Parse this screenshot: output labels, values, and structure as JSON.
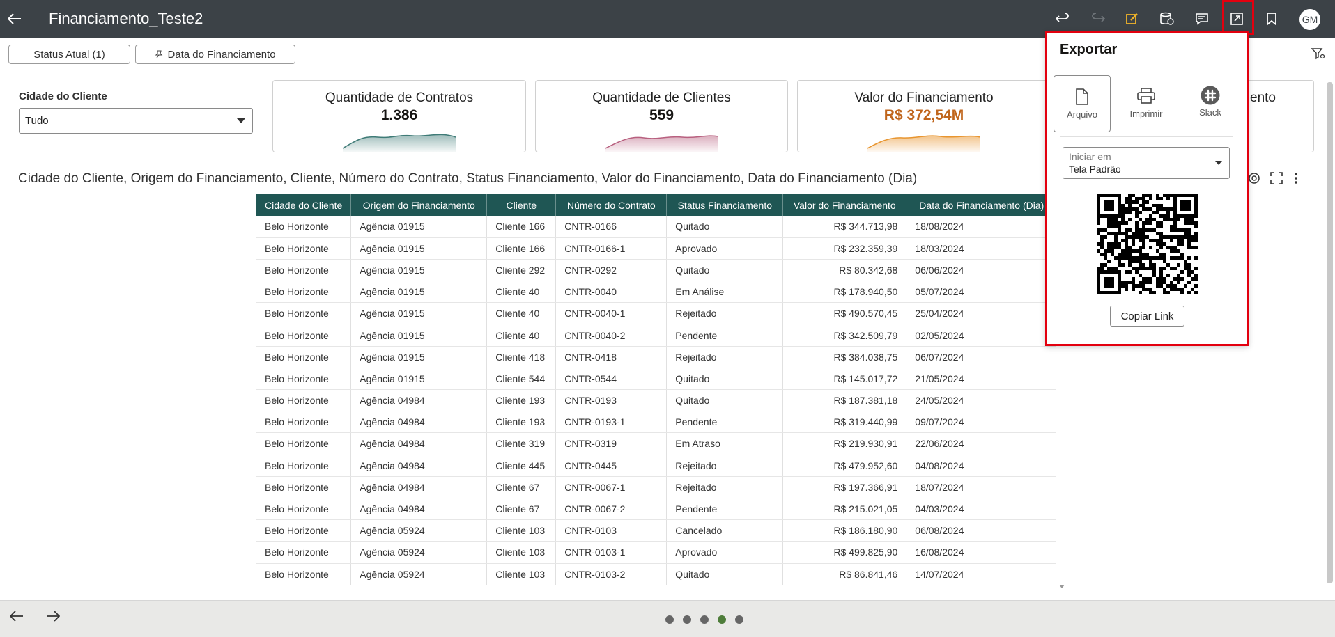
{
  "app": {
    "title": "Financiamento_Teste2",
    "user_initials": "GM"
  },
  "filters": {
    "chips": [
      "Status Atual (1)",
      "Data do Financiamento"
    ],
    "cidade_label": "Cidade do Cliente",
    "cidade_value": "Tudo"
  },
  "kpis": [
    {
      "title": "Quantidade de Contratos",
      "value": "1.386",
      "color": "#3f7b77"
    },
    {
      "title": "Quantidade de Clientes",
      "value": "559",
      "color": "#b8607f"
    },
    {
      "title": "Valor do Financiamento",
      "value": "R$ 372,54M",
      "color": "#e8952f"
    },
    {
      "title": "ento"
    }
  ],
  "table": {
    "title": "Cidade do Cliente, Origem do Financiamento, Cliente, Número do Contrato, Status Financiamento, Valor do Financiamento, Data do Financiamento (Dia)",
    "headers": [
      "Cidade do Cliente",
      "Origem do Financiamento",
      "Cliente",
      "Número do Contrato",
      "Status Financiamento",
      "Valor do Financiamento",
      "Data do Financiamento (Dia)"
    ],
    "rows": [
      [
        "Belo Horizonte",
        "Agência 01915",
        "Cliente 166",
        "CNTR-0166",
        "Quitado",
        "R$ 344.713,98",
        "18/08/2024"
      ],
      [
        "Belo Horizonte",
        "Agência 01915",
        "Cliente 166",
        "CNTR-0166-1",
        "Aprovado",
        "R$ 232.359,39",
        "18/03/2024"
      ],
      [
        "Belo Horizonte",
        "Agência 01915",
        "Cliente 292",
        "CNTR-0292",
        "Quitado",
        "R$ 80.342,68",
        "06/06/2024"
      ],
      [
        "Belo Horizonte",
        "Agência 01915",
        "Cliente 40",
        "CNTR-0040",
        "Em Análise",
        "R$ 178.940,50",
        "05/07/2024"
      ],
      [
        "Belo Horizonte",
        "Agência 01915",
        "Cliente 40",
        "CNTR-0040-1",
        "Rejeitado",
        "R$ 490.570,45",
        "25/04/2024"
      ],
      [
        "Belo Horizonte",
        "Agência 01915",
        "Cliente 40",
        "CNTR-0040-2",
        "Pendente",
        "R$ 342.509,79",
        "02/05/2024"
      ],
      [
        "Belo Horizonte",
        "Agência 01915",
        "Cliente 418",
        "CNTR-0418",
        "Rejeitado",
        "R$ 384.038,75",
        "06/07/2024"
      ],
      [
        "Belo Horizonte",
        "Agência 01915",
        "Cliente 544",
        "CNTR-0544",
        "Quitado",
        "R$ 145.017,72",
        "21/05/2024"
      ],
      [
        "Belo Horizonte",
        "Agência 04984",
        "Cliente 193",
        "CNTR-0193",
        "Quitado",
        "R$ 187.381,18",
        "24/05/2024"
      ],
      [
        "Belo Horizonte",
        "Agência 04984",
        "Cliente 193",
        "CNTR-0193-1",
        "Pendente",
        "R$ 319.440,99",
        "09/07/2024"
      ],
      [
        "Belo Horizonte",
        "Agência 04984",
        "Cliente 319",
        "CNTR-0319",
        "Em Atraso",
        "R$ 219.930,91",
        "22/06/2024"
      ],
      [
        "Belo Horizonte",
        "Agência 04984",
        "Cliente 445",
        "CNTR-0445",
        "Rejeitado",
        "R$ 479.952,60",
        "04/08/2024"
      ],
      [
        "Belo Horizonte",
        "Agência 04984",
        "Cliente 67",
        "CNTR-0067-1",
        "Rejeitado",
        "R$ 197.366,91",
        "18/07/2024"
      ],
      [
        "Belo Horizonte",
        "Agência 04984",
        "Cliente 67",
        "CNTR-0067-2",
        "Pendente",
        "R$ 215.021,05",
        "04/03/2024"
      ],
      [
        "Belo Horizonte",
        "Agência 05924",
        "Cliente 103",
        "CNTR-0103",
        "Cancelado",
        "R$ 186.180,90",
        "06/08/2024"
      ],
      [
        "Belo Horizonte",
        "Agência 05924",
        "Cliente 103",
        "CNTR-0103-1",
        "Aprovado",
        "R$ 499.825,90",
        "16/08/2024"
      ],
      [
        "Belo Horizonte",
        "Agência 05924",
        "Cliente 103",
        "CNTR-0103-2",
        "Quitado",
        "R$ 86.841,46",
        "14/07/2024"
      ]
    ]
  },
  "export": {
    "title": "Exportar",
    "options": [
      "Arquivo",
      "Imprimir",
      "Slack"
    ],
    "start_label": "Iniciar em",
    "start_value": "Tela Padrão",
    "copy_link": "Copiar Link"
  },
  "footer": {
    "page_count": 5,
    "active_page": 4
  },
  "colors": {
    "topbar": "#3c4247",
    "table_header": "#1f5654",
    "highlight": "#e3000f",
    "edit_icon": "#f0b429"
  }
}
